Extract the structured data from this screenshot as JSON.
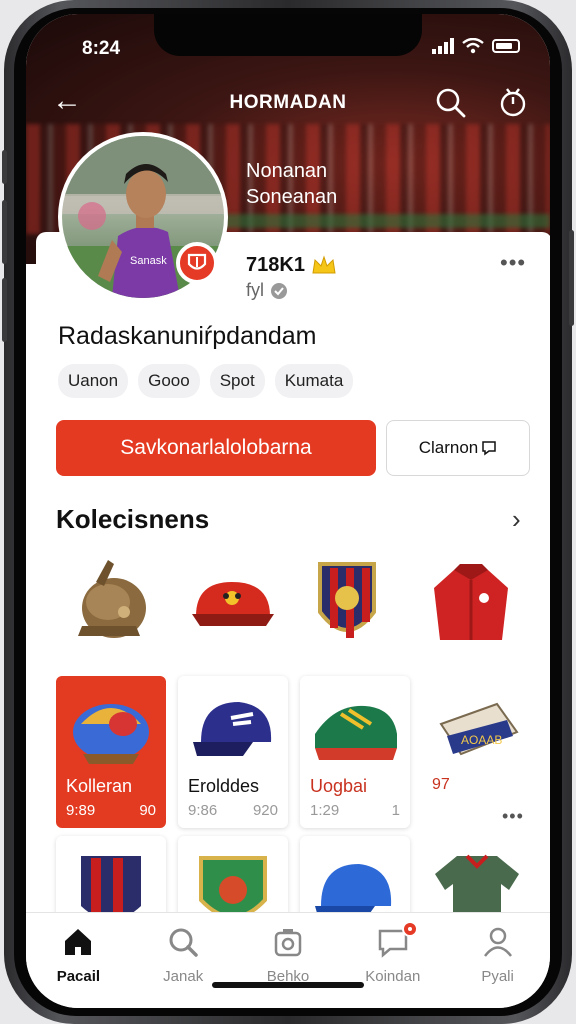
{
  "status": {
    "time": "8:24"
  },
  "header": {
    "title": "HORMADAN"
  },
  "hero": {
    "name_line1": "Nonanan",
    "name_line2": "Soneanan"
  },
  "profile": {
    "id": "718K1",
    "sub": "fyl",
    "headline": "Radaskanuniŕpdandam",
    "chips": [
      "Uanon",
      "Gooo",
      "Spot",
      "Kumata"
    ],
    "primary_button": "Savkonarlalolobarna",
    "secondary_button": "Clarnon"
  },
  "collections": {
    "title": "Kolecisnens",
    "icons": [
      "helmet-icon",
      "cap-icon",
      "crest-icon",
      "jacket-icon"
    ],
    "tiles": [
      {
        "name": "Kolleran",
        "price": "9:89",
        "count": "90"
      },
      {
        "name": "Erolddes",
        "price": "9:86",
        "count": "920"
      },
      {
        "name": "Uogbai",
        "price": "1:29",
        "count": "1"
      },
      {
        "name": "97",
        "price": "",
        "count": ""
      }
    ]
  },
  "tabs": [
    {
      "label": "Pacail",
      "icon": "home-icon"
    },
    {
      "label": "Janak",
      "icon": "search-icon"
    },
    {
      "label": "Behko",
      "icon": "camera-icon"
    },
    {
      "label": "Koindan",
      "icon": "chat-icon"
    },
    {
      "label": "Pyali",
      "icon": "profile-icon"
    }
  ],
  "colors": {
    "accent": "#e43a22",
    "hero_dark": "#1b0a09"
  }
}
